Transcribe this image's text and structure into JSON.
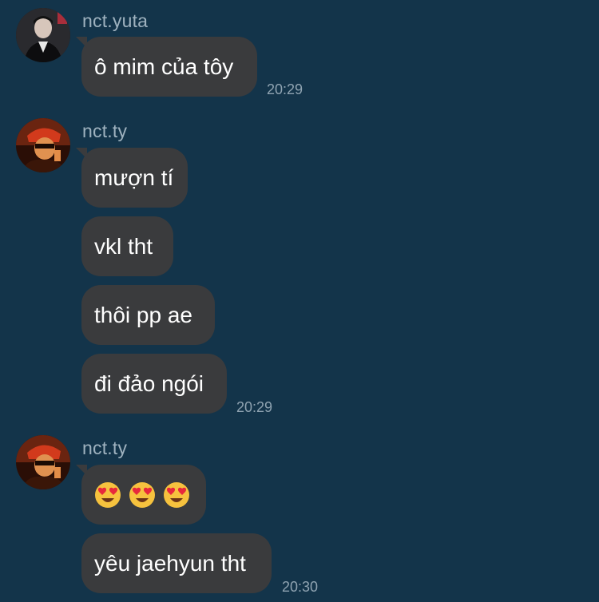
{
  "messages": [
    {
      "sender": "nct.yuta",
      "avatar_icon": "user-avatar-yuta",
      "bubbles": [
        "ô mim của tôy"
      ],
      "time": "20:29"
    },
    {
      "sender": "nct.ty",
      "avatar_icon": "user-avatar-ty",
      "bubbles": [
        "mượn tí",
        "vkl tht",
        "thôi pp ae",
        "đi đảo ngói"
      ],
      "time": "20:29"
    },
    {
      "sender": "nct.ty",
      "avatar_icon": "user-avatar-ty",
      "emoji_bubble": [
        "heart-eyes-emoji",
        "heart-eyes-emoji",
        "heart-eyes-emoji"
      ],
      "bubbles": [
        "yêu jaehyun tht"
      ],
      "time": "20:30"
    }
  ],
  "colors": {
    "background": "#13344a",
    "bubble": "#3a3b3d",
    "sender_text": "#9fb2bf",
    "timestamp": "#8fa3b1"
  }
}
